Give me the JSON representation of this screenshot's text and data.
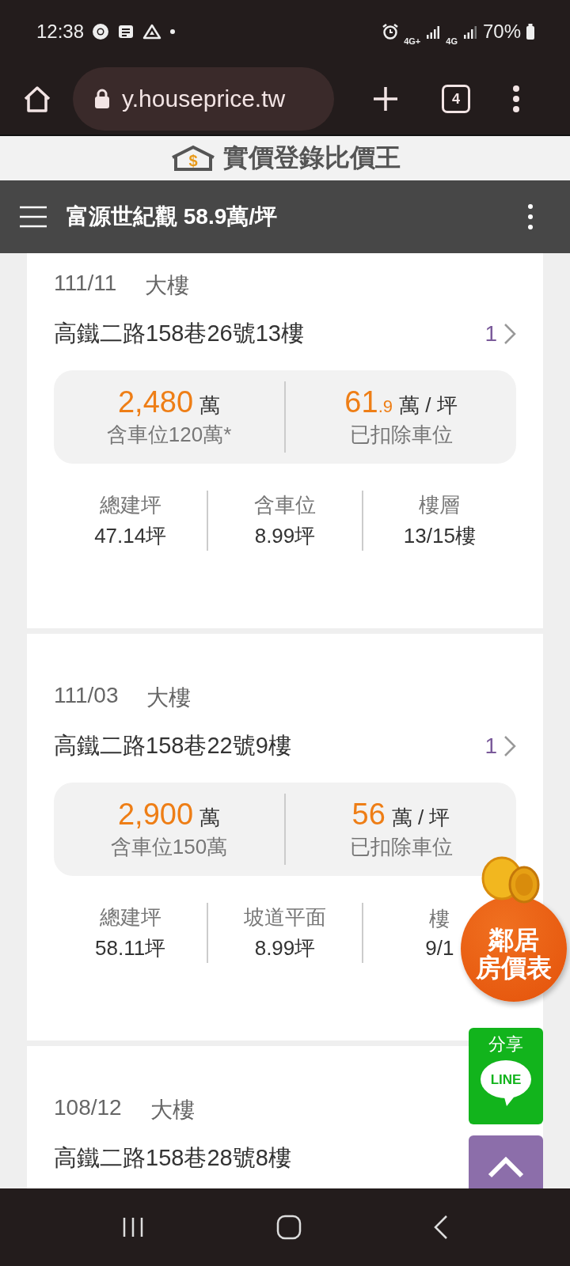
{
  "status_bar": {
    "time": "12:38",
    "network_1": "4G+",
    "network_2": "4G",
    "battery": "70%"
  },
  "browser": {
    "url": "y.houseprice.tw",
    "tab_count": "4"
  },
  "site": {
    "logo_symbol": "$",
    "logo_text": "實價登錄比價王"
  },
  "header": {
    "title": "富源世紀觀 58.9萬/坪"
  },
  "listings": [
    {
      "date": "111/11",
      "type": "大樓",
      "address": "高鐵二路158巷26號13樓",
      "count": "1",
      "total": "2,480",
      "total_unit": "萬",
      "total_note": "含車位120萬*",
      "unit_price": "61",
      "unit_price_decimal": ".9",
      "unit_price_unit": "萬 / 坪",
      "unit_price_note": "已扣除車位",
      "stats": [
        {
          "label": "總建坪",
          "value": "47.14坪"
        },
        {
          "label": "含車位",
          "value": "8.99坪"
        },
        {
          "label": "樓層",
          "value": "13/15樓"
        }
      ]
    },
    {
      "date": "111/03",
      "type": "大樓",
      "address": "高鐵二路158巷22號9樓",
      "count": "1",
      "total": "2,900",
      "total_unit": "萬",
      "total_note": "含車位150萬",
      "unit_price": "56",
      "unit_price_unit": "萬 / 坪",
      "unit_price_note": "已扣除車位",
      "stats": [
        {
          "label": "總建坪",
          "value": "58.11坪"
        },
        {
          "label": "坡道平面",
          "value": "8.99坪"
        },
        {
          "label": "樓",
          "value": "9/1"
        }
      ]
    },
    {
      "date": "108/12",
      "type": "大樓",
      "address": "高鐵二路158巷28號8樓"
    }
  ],
  "floating": {
    "neighbor_badge": [
      "鄰居",
      "房價表"
    ],
    "share_label": "分享",
    "line_logo": "LINE"
  }
}
